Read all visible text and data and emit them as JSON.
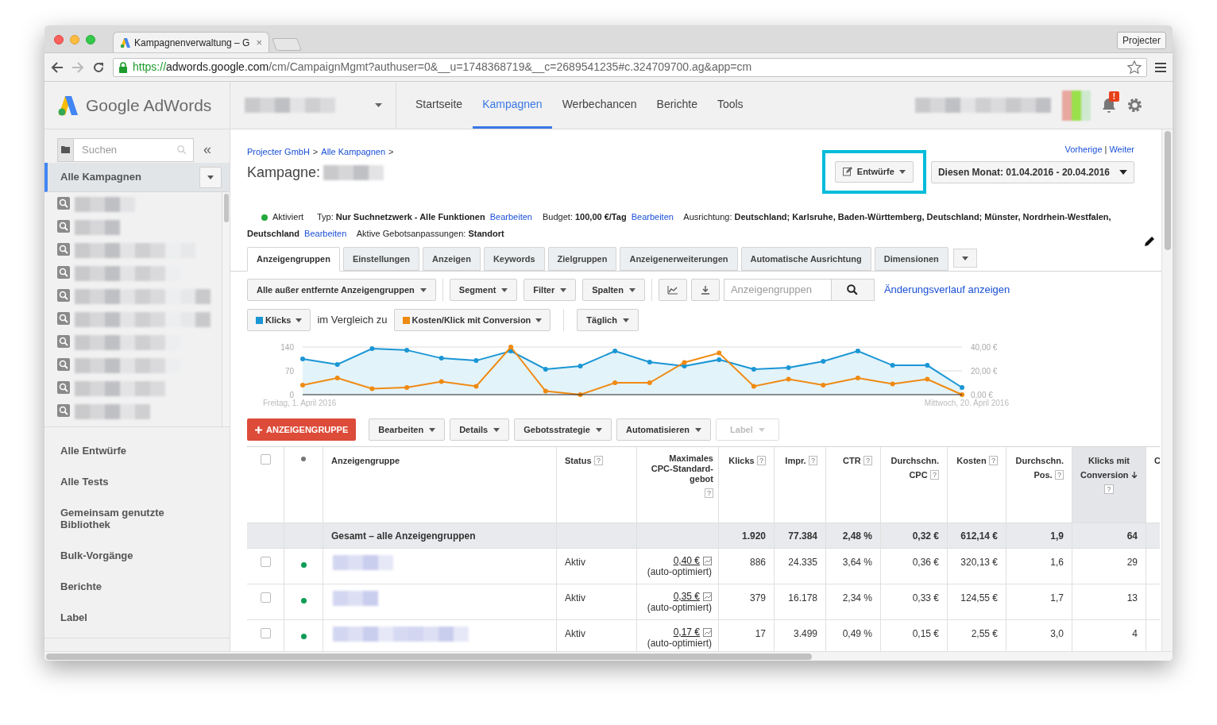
{
  "browser": {
    "tab_title": "Kampagnenverwaltung – G",
    "tab_close": "×",
    "profile_button": "Projecter",
    "url": {
      "scheme": "https://",
      "host": "adwords.google.com",
      "path": "/cm/CampaignMgmt?authuser=0&__u=1748368719&__c=2689541235#c.324709700.ag&app=cm"
    }
  },
  "app_header": {
    "logo_text": "Google AdWords",
    "nav": [
      {
        "label": "Startseite",
        "selected": false
      },
      {
        "label": "Kampagnen",
        "selected": true
      },
      {
        "label": "Werbechancen",
        "selected": false
      },
      {
        "label": "Berichte",
        "selected": false
      },
      {
        "label": "Tools",
        "selected": false
      }
    ],
    "notification_badge": "!"
  },
  "sidebar": {
    "search_placeholder": "Suchen",
    "collapse": "«",
    "current": "Alle Kampagnen",
    "campaigns": [
      {
        "kind": "blurred"
      },
      {
        "kind": "blurred"
      },
      {
        "kind": "blurred"
      },
      {
        "kind": "blurred"
      },
      {
        "kind": "blurred"
      },
      {
        "kind": "blurred"
      },
      {
        "kind": "blurred"
      },
      {
        "kind": "blurred"
      },
      {
        "kind": "blurred"
      },
      {
        "kind": "blurred"
      }
    ],
    "items": [
      "Alle Entwürfe",
      "Alle Tests",
      "Gemeinsam genutzte Bibliothek",
      "Bulk-Vorgänge",
      "Berichte",
      "Label"
    ]
  },
  "page": {
    "breadcrumb": [
      "Projecter GmbH",
      "Alle Kampagnen"
    ],
    "breadcrumb_separator": ">",
    "title": "Kampagne:",
    "pager": [
      "Vorherige",
      "Weiter"
    ],
    "pager_separator": "|",
    "drafts_button": "Entwürfe",
    "drafts_highlighted": true,
    "date_range": "Diesen Monat: 01.04.2016 - 20.04.2016"
  },
  "campaign_info": [
    {
      "kind": "status",
      "text": "Aktiviert",
      "color": "#22a83a"
    },
    {
      "kind": "text",
      "text": "Typ: **Nur Suchnetzwerk - Alle Funktionen**"
    },
    {
      "kind": "link",
      "text": "Bearbeiten"
    },
    {
      "kind": "text",
      "text": "Budget: **100,00 €/Tag**"
    },
    {
      "kind": "link",
      "text": "Bearbeiten"
    },
    {
      "kind": "text",
      "text": "Ausrichtung: **Deutschland; Karlsruhe, Baden-Württemberg, Deutschland; Münster, Nordrhein-Westfalen, Deutschland**"
    },
    {
      "kind": "link",
      "text": "Bearbeiten"
    },
    {
      "kind": "text",
      "text": "Aktive Gebotsanpassungen: **Standort**"
    }
  ],
  "tabs": [
    {
      "label": "Anzeigengruppen",
      "selected": true
    },
    {
      "label": "Einstellungen",
      "selected": false
    },
    {
      "label": "Anzeigen",
      "selected": false
    },
    {
      "label": "Keywords",
      "selected": false
    },
    {
      "label": "Zielgruppen",
      "selected": false
    },
    {
      "label": "Anzeigenerweiterungen",
      "selected": false
    },
    {
      "label": "Automatische Ausrichtung",
      "selected": false
    },
    {
      "label": "Dimensionen",
      "selected": false
    }
  ],
  "toolbar": {
    "dropdowns": [
      "Alle außer entfernte Anzeigengruppen",
      "Segment",
      "Filter",
      "Spalten"
    ],
    "search_placeholder": "Anzeigengruppen",
    "history_link": "Änderungsverlauf anzeigen"
  },
  "metrics": {
    "compare_text": "im Vergleich zu",
    "interval": "Täglich",
    "date_start": "Freitag, 1. April 2016",
    "date_end": "Mittwoch, 20. April 2016"
  },
  "chart_data": {
    "type": "area",
    "ylim": [
      0,
      140
    ],
    "yticks": [
      0,
      70,
      140
    ],
    "y2lim": [
      0,
      40
    ],
    "y2ticks": [
      {
        "value": 0,
        "label": "0,00 €"
      },
      {
        "value": 20,
        "label": "20,00 €"
      },
      {
        "value": 40,
        "label": "40,00 €"
      }
    ],
    "series": [
      {
        "name": "Klicks",
        "color": "#1a96d4",
        "marker": "o",
        "values": [
          105,
          89,
          135,
          131,
          107,
          100,
          128,
          75,
          84,
          128,
          96,
          84,
          103,
          75,
          79,
          98,
          128,
          86,
          86,
          21
        ]
      },
      {
        "name": "Kosten/Klick mit Conversion",
        "color": "#ef8a12",
        "axis": "y2",
        "marker": "o",
        "type": "line",
        "values": [
          8,
          14,
          5,
          6,
          11,
          7,
          40,
          3,
          0,
          10,
          10,
          27,
          35,
          7,
          13,
          8,
          14,
          9,
          13,
          0
        ]
      }
    ]
  },
  "actions": {
    "add_button": "ANZEIGENGRUPPE",
    "menus": [
      {
        "label": "Bearbeiten",
        "disabled": false
      },
      {
        "label": "Details",
        "disabled": false
      },
      {
        "label": "Gebotsstrategie",
        "disabled": false
      },
      {
        "label": "Automatisieren",
        "disabled": false
      },
      {
        "label": "Label",
        "disabled": true
      }
    ]
  },
  "table": {
    "columns": [
      {
        "kind": "checkbox",
        "checked": false
      },
      {
        "kind": "dot"
      },
      {
        "kind": "text",
        "label": "Anzeigengruppe"
      },
      {
        "kind": "text",
        "label": "Status",
        "help": "?"
      },
      {
        "kind": "number",
        "label": "Maximales CPC-Standard-gebot",
        "help": "?"
      },
      {
        "kind": "number",
        "label": "Klicks",
        "help": "?"
      },
      {
        "kind": "number",
        "label": "Impr.",
        "help": "?"
      },
      {
        "kind": "number",
        "label": "CTR",
        "help": "?"
      },
      {
        "kind": "number",
        "label": "Durchschn. CPC",
        "help": "?"
      },
      {
        "kind": "number",
        "label": "Kosten",
        "help": "?"
      },
      {
        "kind": "number",
        "label": "Durchschn. Pos.",
        "help": "?"
      },
      {
        "kind": "number",
        "label": "Klicks mit Conversion",
        "help": "?",
        "sorted": true
      },
      {
        "kind": "text",
        "label": "C"
      }
    ],
    "total_row": {
      "label": "Gesamt – alle Anzeigengruppen",
      "values": [
        "1.920",
        "77.384",
        "2,48 %",
        "0,32 €",
        "612,14 €",
        "1,9",
        "64"
      ]
    },
    "rows": [
      {
        "checked": false,
        "color": "#0f9d58",
        "status": "Aktiv",
        "bid": "0,40 €",
        "bid_note": "(auto-optimiert)",
        "values": [
          "886",
          "24.335",
          "3,64 %",
          "0,36 €",
          "320,13 €",
          "1,6",
          "29"
        ]
      },
      {
        "checked": false,
        "color": "#0f9d58",
        "status": "Aktiv",
        "bid": "0,35 €",
        "bid_note": "(auto-optimiert)",
        "values": [
          "379",
          "16.178",
          "2,34 %",
          "0,33 €",
          "124,55 €",
          "1,7",
          "13"
        ]
      },
      {
        "checked": false,
        "color": "#0f9d58",
        "status": "Aktiv",
        "bid": "0,17 €",
        "bid_note": "(auto-optimiert)",
        "values": [
          "17",
          "3.499",
          "0,49 %",
          "0,15 €",
          "2,55 €",
          "3,0",
          "4"
        ]
      }
    ]
  }
}
